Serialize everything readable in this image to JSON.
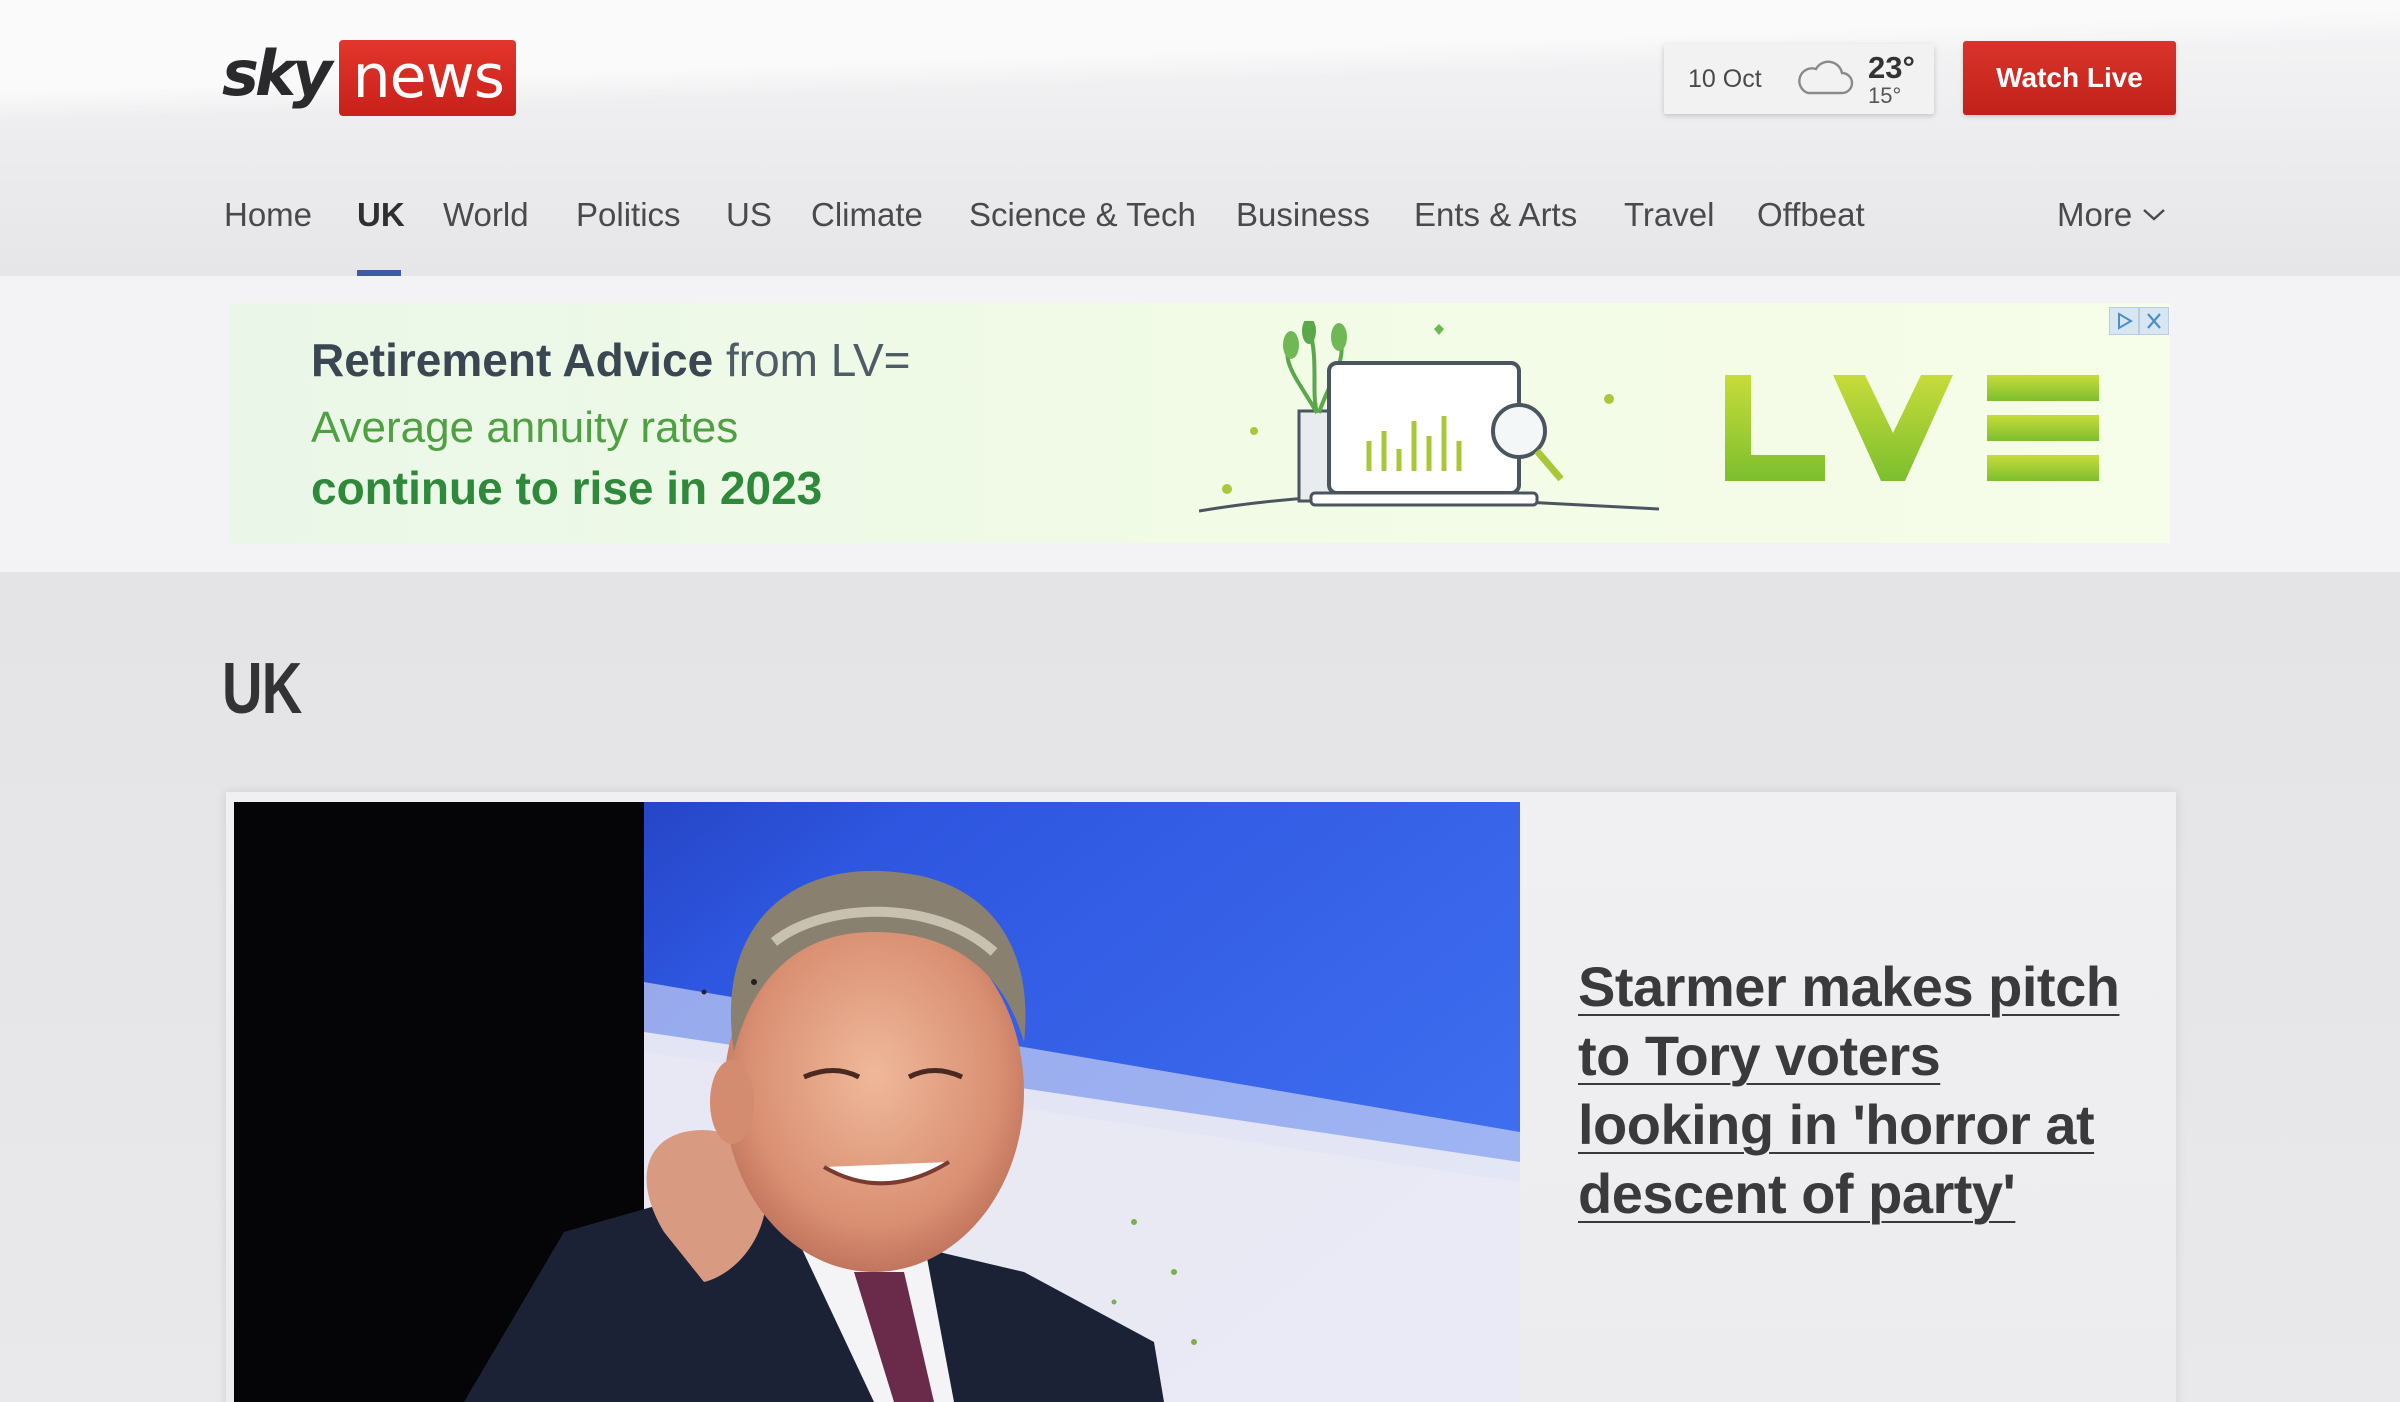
{
  "header": {
    "logo": {
      "sky": "sky",
      "news": "news"
    },
    "weather": {
      "date": "10 Oct",
      "high": "23°",
      "low": "15°",
      "icon": "cloud-icon"
    },
    "watch_live": "Watch Live"
  },
  "nav": {
    "items": [
      "Home",
      "UK",
      "World",
      "Politics",
      "US",
      "Climate",
      "Science & Tech",
      "Business",
      "Ents & Arts",
      "Travel",
      "Offbeat"
    ],
    "active": "UK",
    "more": "More"
  },
  "ad": {
    "line1_bold": "Retirement Advice",
    "line1_rest": " from LV=",
    "line2": "Average annuity rates",
    "line3": "continue to rise in 2023",
    "brand": "LV="
  },
  "page": {
    "title": "UK"
  },
  "lead_story": {
    "headline": "Starmer makes pitch to Tory voters looking in 'horror at descent of party'"
  },
  "colors": {
    "brand_red": "#c8201a",
    "nav_active": "#3c5aa6",
    "ad_green": "#2e8a3a"
  }
}
